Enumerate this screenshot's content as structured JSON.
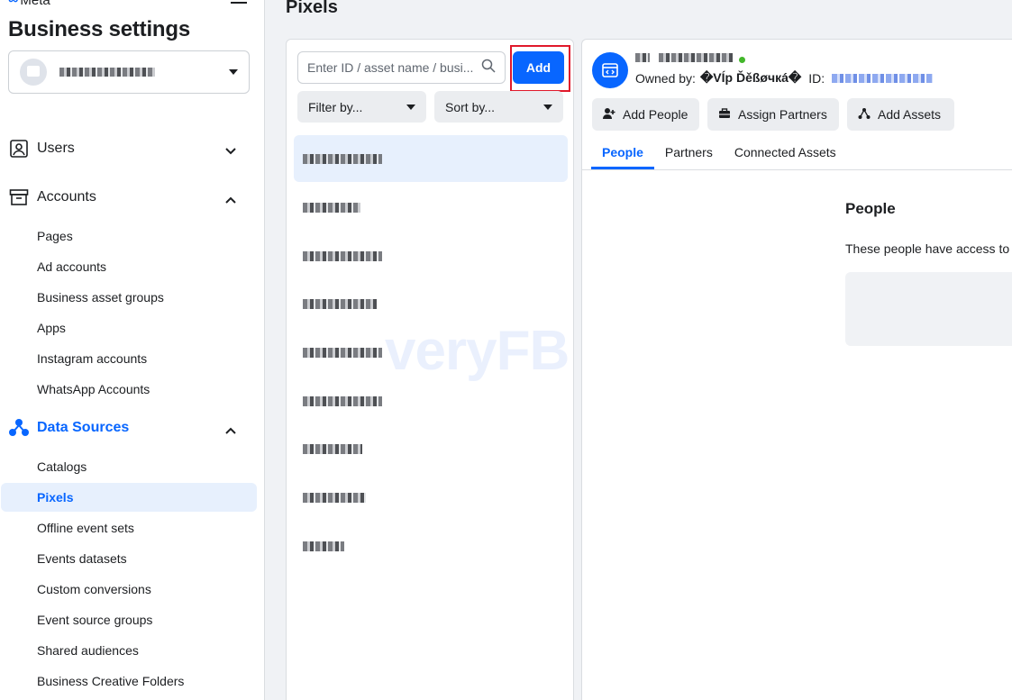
{
  "sidebar": {
    "logo_text": "Meta",
    "title": "Business settings",
    "sections": {
      "users": {
        "label": "Users"
      },
      "accounts": {
        "label": "Accounts",
        "items": [
          "Pages",
          "Ad accounts",
          "Business asset groups",
          "Apps",
          "Instagram accounts",
          "WhatsApp Accounts"
        ]
      },
      "data_sources": {
        "label": "Data Sources",
        "items": [
          "Catalogs",
          "Pixels",
          "Offline event sets",
          "Events datasets",
          "Custom conversions",
          "Event source groups",
          "Shared audiences",
          "Business Creative Folders"
        ]
      }
    }
  },
  "main": {
    "title": "Pixels"
  },
  "list_panel": {
    "search_placeholder": "Enter ID / asset name / busi...",
    "add_label": "Add",
    "filter_label": "Filter by...",
    "sort_label": "Sort by..."
  },
  "detail": {
    "owned_by_label": "Owned by:",
    "owner_name": "�VÍр Ďěßøчкá�",
    "id_label": "ID:",
    "actions": {
      "add_people": "Add People",
      "assign_partners": "Assign Partners",
      "add_assets": "Add Assets"
    },
    "tabs": [
      "People",
      "Partners",
      "Connected Assets"
    ],
    "people_heading": "People",
    "people_desc": "These people have access to t"
  },
  "watermark": "veryFB",
  "colors": {
    "accent": "#0866ff",
    "highlight_box": "#e0192b",
    "status_online": "#42b72a"
  }
}
